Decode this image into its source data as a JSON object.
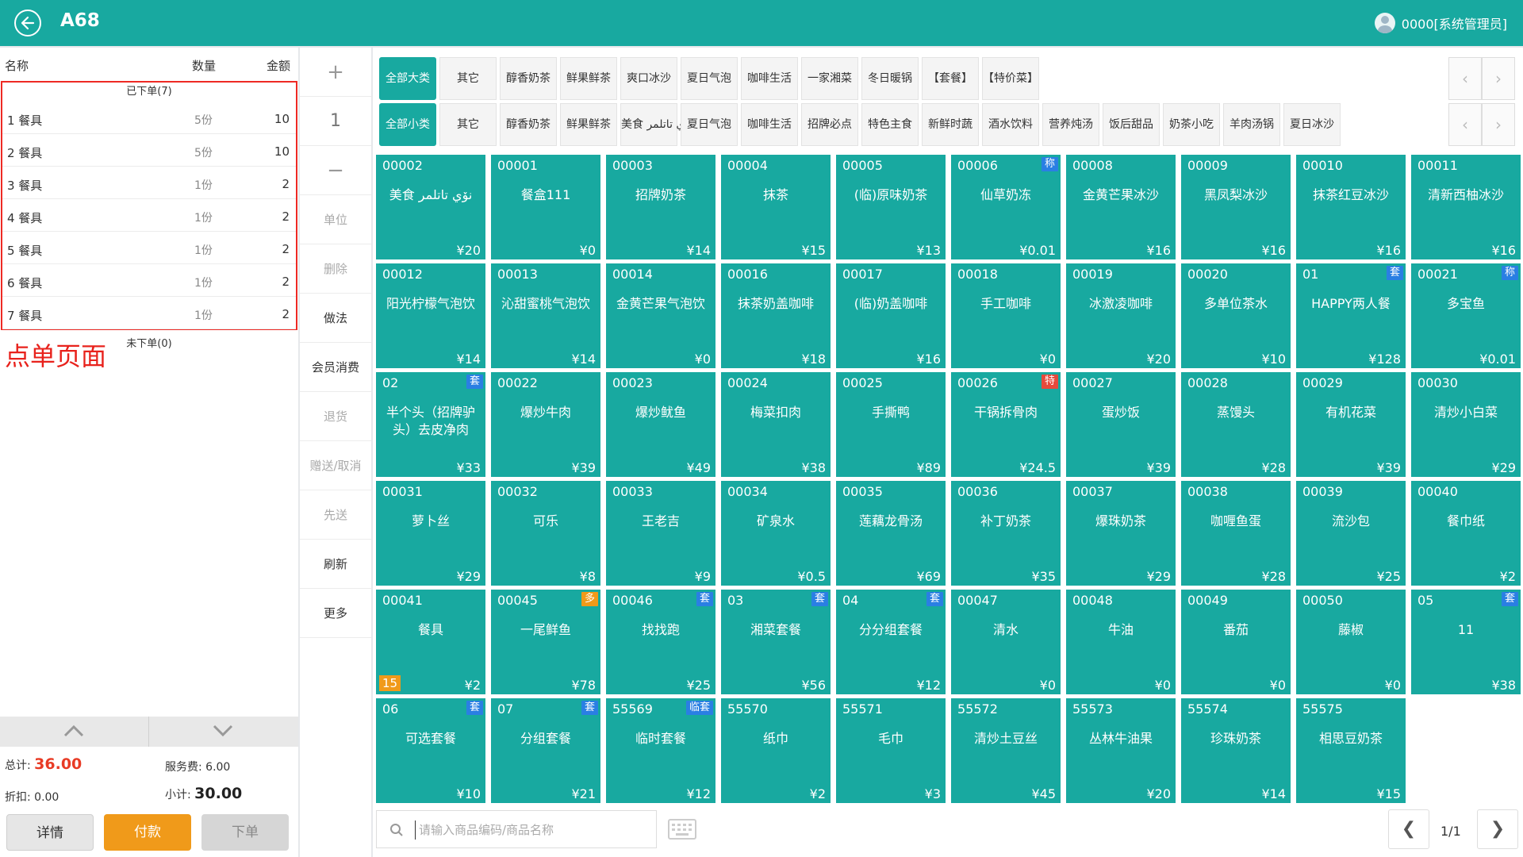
{
  "header": {
    "title": "A68",
    "user": "0000[系统管理员]"
  },
  "order_table": {
    "col_name": "名称",
    "col_qty": "数量",
    "col_amount": "金额",
    "ordered_label": "已下单(7)",
    "rows": [
      {
        "name": "1 餐具",
        "qty": "5份",
        "amount": "10"
      },
      {
        "name": "2 餐具",
        "qty": "5份",
        "amount": "10"
      },
      {
        "name": "3 餐具",
        "qty": "1份",
        "amount": "2"
      },
      {
        "name": "4 餐具",
        "qty": "1份",
        "amount": "2"
      },
      {
        "name": "5 餐具",
        "qty": "1份",
        "amount": "2"
      },
      {
        "name": "6 餐具",
        "qty": "1份",
        "amount": "2"
      },
      {
        "name": "7 餐具",
        "qty": "1份",
        "amount": "2"
      }
    ],
    "unordered_label": "未下单(0)"
  },
  "annotation": "点单页面",
  "totals": {
    "total_label": "总计:",
    "total_value": "36.00",
    "service_label": "服务费: 6.00",
    "discount_label": "折扣: 0.00",
    "subtotal_label": "小计:",
    "subtotal_value": "30.00"
  },
  "bottom_buttons": {
    "detail": "详情",
    "pay": "付款",
    "submit": "下单"
  },
  "mid_buttons": {
    "plus": "+",
    "qty": "1",
    "minus": "−",
    "unit": "单位",
    "delete": "删除",
    "method": "做法",
    "member": "会员消费",
    "return": "退货",
    "gift": "赠送/取消",
    "first": "先送",
    "refresh": "刷新",
    "more": "更多"
  },
  "big_categories": [
    "全部大类",
    "其它",
    "醇香奶茶",
    "鲜果鲜茶",
    "爽口冰沙",
    "夏日气泡",
    "咖啡生活",
    "一家湘菜",
    "冬日暖锅",
    "【套餐】",
    "【特价菜】"
  ],
  "small_categories": [
    "全部小类",
    "其它",
    "醇香奶茶",
    "鲜果鲜茶",
    "美食 نۆي تاتلمر",
    "夏日气泡",
    "咖啡生活",
    "招牌必点",
    "特色主食",
    "新鲜时蔬",
    "酒水饮料",
    "营养炖汤",
    "饭后甜品",
    "奶茶小吃",
    "羊肉汤锅",
    "夏日冰沙"
  ],
  "products": [
    {
      "code": "00002",
      "name": "美食 نۆي تاتلمر",
      "price": "¥20"
    },
    {
      "code": "00001",
      "name": "餐盒111",
      "price": "¥0"
    },
    {
      "code": "00003",
      "name": "招牌奶茶",
      "price": "¥14"
    },
    {
      "code": "00004",
      "name": "抹茶",
      "price": "¥15"
    },
    {
      "code": "00005",
      "name": "(临)原味奶茶",
      "price": "¥13"
    },
    {
      "code": "00006",
      "name": "仙草奶冻",
      "price": "¥0.01",
      "tag": "称",
      "tag_color": "#2a7fe3"
    },
    {
      "code": "00008",
      "name": "金黄芒果冰沙",
      "price": "¥16"
    },
    {
      "code": "00009",
      "name": "黑凤梨冰沙",
      "price": "¥16"
    },
    {
      "code": "00010",
      "name": "抹茶红豆冰沙",
      "price": "¥16"
    },
    {
      "code": "00011",
      "name": "清新西柚冰沙",
      "price": "¥16"
    },
    {
      "code": "00012",
      "name": "阳光柠檬气泡饮",
      "price": "¥14"
    },
    {
      "code": "00013",
      "name": "沁甜蜜桃气泡饮",
      "price": "¥14"
    },
    {
      "code": "00014",
      "name": "金黄芒果气泡饮",
      "price": "¥0"
    },
    {
      "code": "00016",
      "name": "抹茶奶盖咖啡",
      "price": "¥18"
    },
    {
      "code": "00017",
      "name": "(临)奶盖咖啡",
      "price": "¥16"
    },
    {
      "code": "00018",
      "name": "手工咖啡",
      "price": "¥0"
    },
    {
      "code": "00019",
      "name": "冰激凌咖啡",
      "price": "¥20"
    },
    {
      "code": "00020",
      "name": "多单位茶水",
      "price": "¥10"
    },
    {
      "code": "01",
      "name": "HAPPY两人餐",
      "price": "¥128",
      "tag": "套",
      "tag_color": "#2a7fe3"
    },
    {
      "code": "00021",
      "name": "多宝鱼",
      "price": "¥0.01",
      "tag": "称",
      "tag_color": "#2a7fe3"
    },
    {
      "code": "02",
      "name": "半个头（招牌驴头）去皮净肉",
      "price": "¥33",
      "tag": "套",
      "tag_color": "#2a7fe3"
    },
    {
      "code": "00022",
      "name": "爆炒牛肉",
      "price": "¥39"
    },
    {
      "code": "00023",
      "name": "爆炒鱿鱼",
      "price": "¥49"
    },
    {
      "code": "00024",
      "name": "梅菜扣肉",
      "price": "¥38"
    },
    {
      "code": "00025",
      "name": "手撕鸭",
      "price": "¥89"
    },
    {
      "code": "00026",
      "name": "干锅拆骨肉",
      "price": "¥24.5",
      "tag": "特",
      "tag_color": "#e64a3c"
    },
    {
      "code": "00027",
      "name": "蛋炒饭",
      "price": "¥39"
    },
    {
      "code": "00028",
      "name": "蒸馒头",
      "price": "¥28"
    },
    {
      "code": "00029",
      "name": "有机花菜",
      "price": "¥39"
    },
    {
      "code": "00030",
      "name": "清炒小白菜",
      "price": "¥29"
    },
    {
      "code": "00031",
      "name": "萝卜丝",
      "price": "¥29"
    },
    {
      "code": "00032",
      "name": "可乐",
      "price": "¥8"
    },
    {
      "code": "00033",
      "name": "王老吉",
      "price": "¥9"
    },
    {
      "code": "00034",
      "name": "矿泉水",
      "price": "¥0.5"
    },
    {
      "code": "00035",
      "name": "莲藕龙骨汤",
      "price": "¥69"
    },
    {
      "code": "00036",
      "name": "补丁奶茶",
      "price": "¥35"
    },
    {
      "code": "00037",
      "name": "爆珠奶茶",
      "price": "¥29"
    },
    {
      "code": "00038",
      "name": "咖喱鱼蛋",
      "price": "¥28"
    },
    {
      "code": "00039",
      "name": "流沙包",
      "price": "¥25"
    },
    {
      "code": "00040",
      "name": "餐巾纸",
      "price": "¥2"
    },
    {
      "code": "00041",
      "name": "餐具",
      "price": "¥2",
      "count": "15"
    },
    {
      "code": "00045",
      "name": "一尾鲜鱼",
      "price": "¥78",
      "tag": "多",
      "tag_color": "#f09a1a"
    },
    {
      "code": "00046",
      "name": "找找跑",
      "price": "¥25",
      "tag": "套",
      "tag_color": "#2a7fe3"
    },
    {
      "code": "03",
      "name": "湘菜套餐",
      "price": "¥56",
      "tag": "套",
      "tag_color": "#2a7fe3"
    },
    {
      "code": "04",
      "name": "分分组套餐",
      "price": "¥12",
      "tag": "套",
      "tag_color": "#2a7fe3"
    },
    {
      "code": "00047",
      "name": "清水",
      "price": "¥0"
    },
    {
      "code": "00048",
      "name": "牛油",
      "price": "¥0"
    },
    {
      "code": "00049",
      "name": "番茄",
      "price": "¥0"
    },
    {
      "code": "00050",
      "name": "藤椒",
      "price": "¥0"
    },
    {
      "code": "05",
      "name": "11",
      "price": "¥38",
      "tag": "套",
      "tag_color": "#2a7fe3"
    },
    {
      "code": "06",
      "name": "可选套餐",
      "price": "¥10",
      "tag": "套",
      "tag_color": "#2a7fe3"
    },
    {
      "code": "07",
      "name": "分组套餐",
      "price": "¥21",
      "tag": "套",
      "tag_color": "#2a7fe3"
    },
    {
      "code": "55569",
      "name": "临时套餐",
      "price": "¥12",
      "tag": "临套",
      "tag_color": "#2a7fe3"
    },
    {
      "code": "55570",
      "name": "纸巾",
      "price": "¥2"
    },
    {
      "code": "55571",
      "name": "毛巾",
      "price": "¥3"
    },
    {
      "code": "55572",
      "name": "清炒土豆丝",
      "price": "¥45"
    },
    {
      "code": "55573",
      "name": "丛林牛油果",
      "price": "¥20"
    },
    {
      "code": "55574",
      "name": "珍珠奶茶",
      "price": "¥14"
    },
    {
      "code": "55575",
      "name": "相思豆奶茶",
      "price": "¥15"
    }
  ],
  "search": {
    "placeholder": "请输入商品编码/商品名称"
  },
  "pager": {
    "text": "1/1"
  }
}
